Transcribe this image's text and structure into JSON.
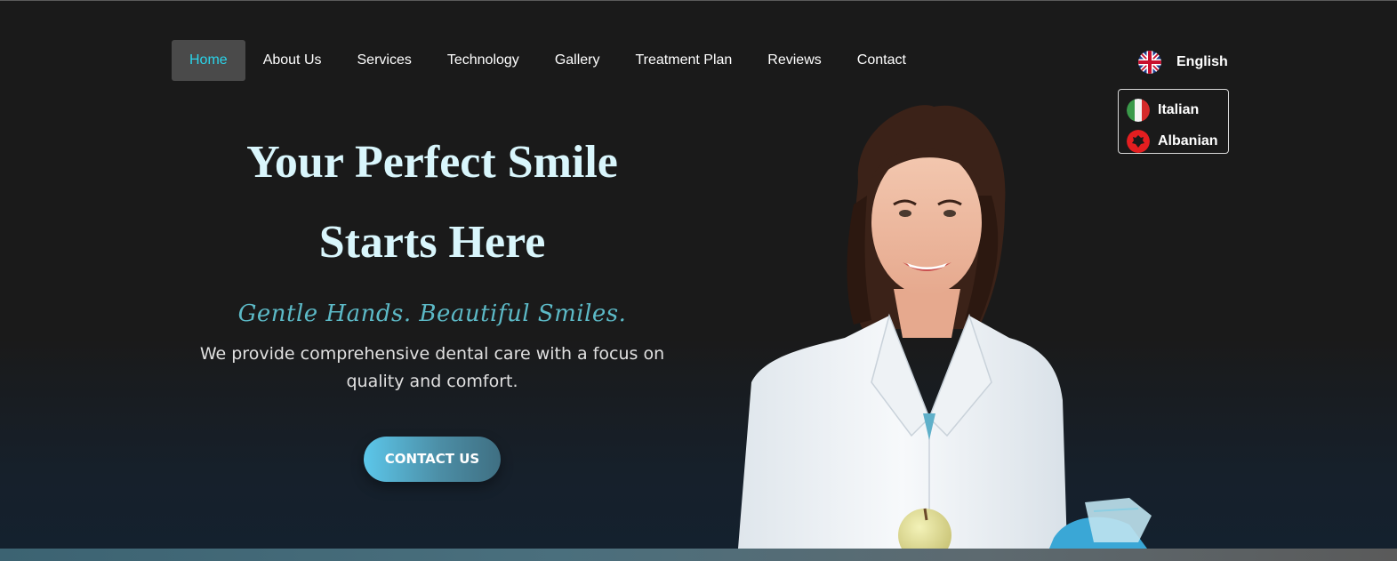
{
  "nav": {
    "items": [
      {
        "label": "Home",
        "active": true
      },
      {
        "label": "About Us"
      },
      {
        "label": "Services"
      },
      {
        "label": "Technology"
      },
      {
        "label": "Gallery"
      },
      {
        "label": "Treatment Plan"
      },
      {
        "label": "Reviews"
      },
      {
        "label": "Contact"
      }
    ]
  },
  "language": {
    "current": {
      "label": "English",
      "icon": "uk-flag-icon"
    },
    "options": [
      {
        "label": "Italian",
        "icon": "italy-flag-icon"
      },
      {
        "label": "Albanian",
        "icon": "albania-flag-icon"
      }
    ]
  },
  "hero": {
    "title_line1": "Your Perfect Smile",
    "title_line2": "Starts Here",
    "tagline": "Gentle Hands. Beautiful Smiles.",
    "description": "We provide comprehensive dental care with a focus on quality and comfort.",
    "cta_label": "CONTACT US",
    "image": "dentist-portrait"
  },
  "colors": {
    "background": "#1a1a1a",
    "accent_cyan": "#2ad4ea",
    "title": "#d9f6fc",
    "tagline": "#5cb9c6",
    "cta_start": "#5cc7ea",
    "cta_end": "#3f6f82"
  }
}
